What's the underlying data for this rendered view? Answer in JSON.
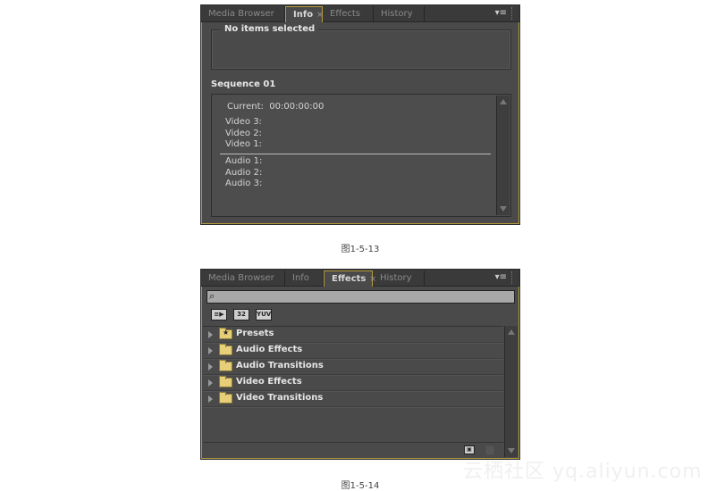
{
  "tabs": [
    "Media Browser",
    "Info",
    "Effects",
    "History"
  ],
  "close_glyph": "×",
  "panel_menu_icon": "▾≡",
  "info_panel": {
    "active_tab": "Info",
    "selection_title": "No items selected",
    "sequence_title": "Sequence 01",
    "current_label": "Current:",
    "current_value": "00:00:00:00",
    "video_tracks": [
      "Video 3:",
      "Video 2:",
      "Video 1:"
    ],
    "audio_tracks": [
      "Audio 1:",
      "Audio 2:",
      "Audio 3:"
    ]
  },
  "effects_panel": {
    "active_tab": "Effects",
    "search_value": "",
    "search_icon": "⌕",
    "filter_buttons": [
      "≡▶",
      "32",
      "YUV"
    ],
    "items": [
      {
        "label": "Presets",
        "icon": "presets-folder"
      },
      {
        "label": "Audio Effects",
        "icon": "folder"
      },
      {
        "label": "Audio Transitions",
        "icon": "folder"
      },
      {
        "label": "Video Effects",
        "icon": "folder"
      },
      {
        "label": "Video Transitions",
        "icon": "folder"
      }
    ]
  },
  "captions": [
    "图1-5-13",
    "图1-5-14"
  ],
  "watermark": "云栖社区 yq.aliyun.com"
}
